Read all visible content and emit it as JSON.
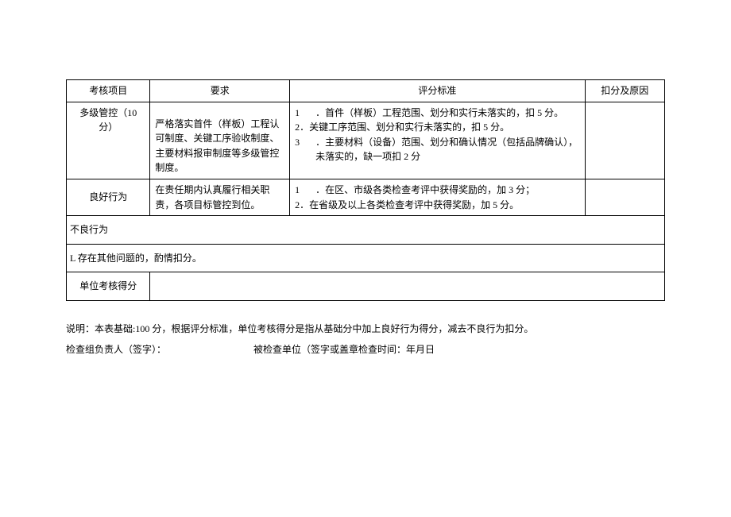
{
  "headers": {
    "item": "考核项目",
    "requirement": "要求",
    "criteria": "评分标准",
    "deduction": "扣分及原因"
  },
  "rows": {
    "r1": {
      "item": "多级管控（10 分）",
      "requirement": "严格落实首件（样板）工程认可制度、关键工序验收制度、主要材料报审制度等多级管控制度。",
      "criteria_1_num": "1",
      "criteria_1_txt": "．首件（样板）工程范围、划分和实行未落实的，扣 5 分。",
      "criteria_2": "2．关键工序范围、划分和实行未落实的，扣 5 分。",
      "criteria_3_num": "3",
      "criteria_3_txt": "．主要材料（设备）范围、划分和确认情况（包括品牌确认），未落实的，缺一项扣 2 分"
    },
    "r2": {
      "item": "良好行为",
      "requirement": "在责任期内认真履行相关职责，各项目标管控到位。",
      "criteria_1_num": "1",
      "criteria_1_txt": "．在区、市级各类检查考评中获得奖励的，加 3 分；",
      "criteria_2": "2．在省级及以上各类检查考评中获得奖励，加 5 分。"
    },
    "r3": {
      "full": "不良行为"
    },
    "r4": {
      "full": "L 存在其他问题的，酌情扣分。"
    },
    "r5": {
      "item": "单位考核得分"
    }
  },
  "notes": {
    "n1": "说明：本表基础:100 分，根据评分标准，单位考核得分是指从基础分中加上良好行为得分，减去不良行为扣分。",
    "n2a": "检查组负责人（签字）：",
    "n2b": "被检查单位（签字或盖章检查时间：年月日"
  }
}
